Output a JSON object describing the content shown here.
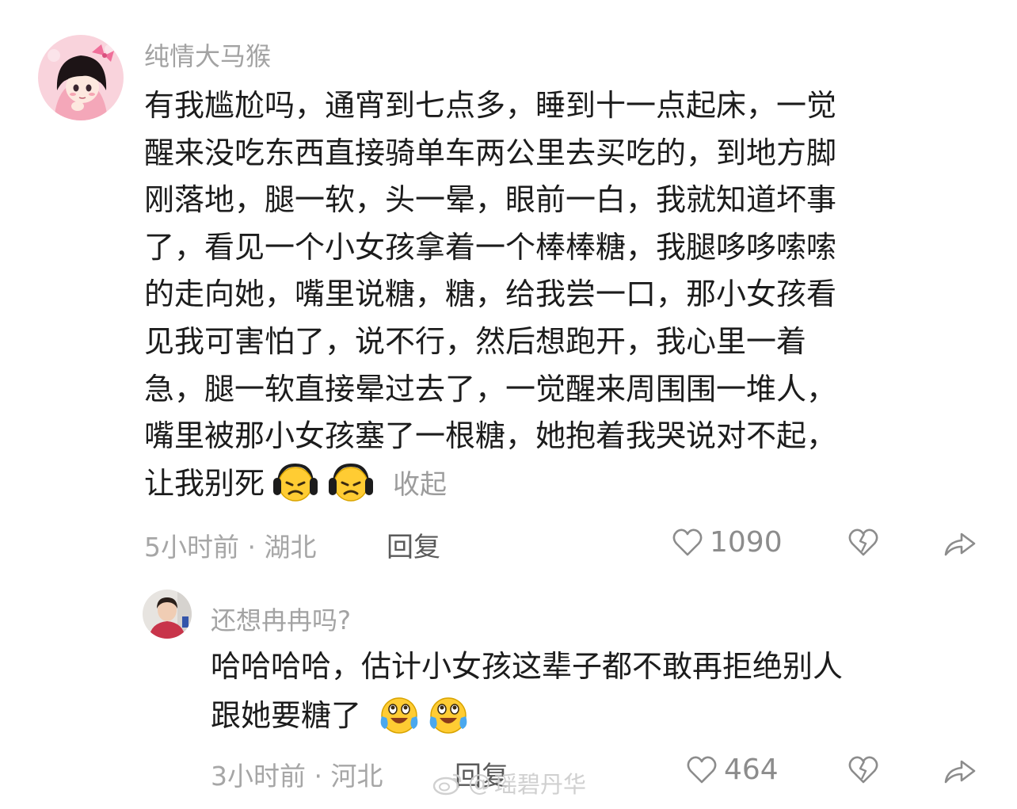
{
  "comment": {
    "username": "纯情大马猴",
    "text_lines": [
      "有我尴尬吗，通宵到七点多，睡到十一点起床，一觉",
      "醒来没吃东西直接骑单车两公里去买吃的，到地方脚",
      "刚落地，腿一软，头一晕，眼前一白，我就知道坏事",
      "了，看见一个小女孩拿着一个棒棒糖，我腿哆哆嗦嗦",
      "的走向她，嘴里说糖，糖，给我尝一口，那小女孩看",
      "见我可害怕了，说不行，然后想跑开，我心里一着",
      "急，腿一软直接晕过去了，一觉醒来周围围一堆人，",
      "嘴里被那小女孩塞了一根糖，她抱着我哭说对不起，",
      "让我别死"
    ],
    "emoji_icon": "sad-headphones-emoji",
    "collapse_label": "收起",
    "meta": "5小时前 · 湖北",
    "reply_label": "回复",
    "likes": "1090"
  },
  "reply": {
    "username": "还想冉冉吗?",
    "text_lines": [
      "哈哈哈哈，估计小女孩这辈子都不敢再拒绝别人",
      "跟她要糖了"
    ],
    "emoji_icon": "laugh-cry-emoji",
    "meta": "3小时前 · 河北",
    "reply_label": "回复",
    "likes": "464"
  },
  "watermark": {
    "at": "@",
    "name": "瑶碧丹华"
  },
  "colors": {
    "text": "#1c1c1c",
    "muted": "#a3a3a3",
    "icon": "#8c8c8c"
  }
}
